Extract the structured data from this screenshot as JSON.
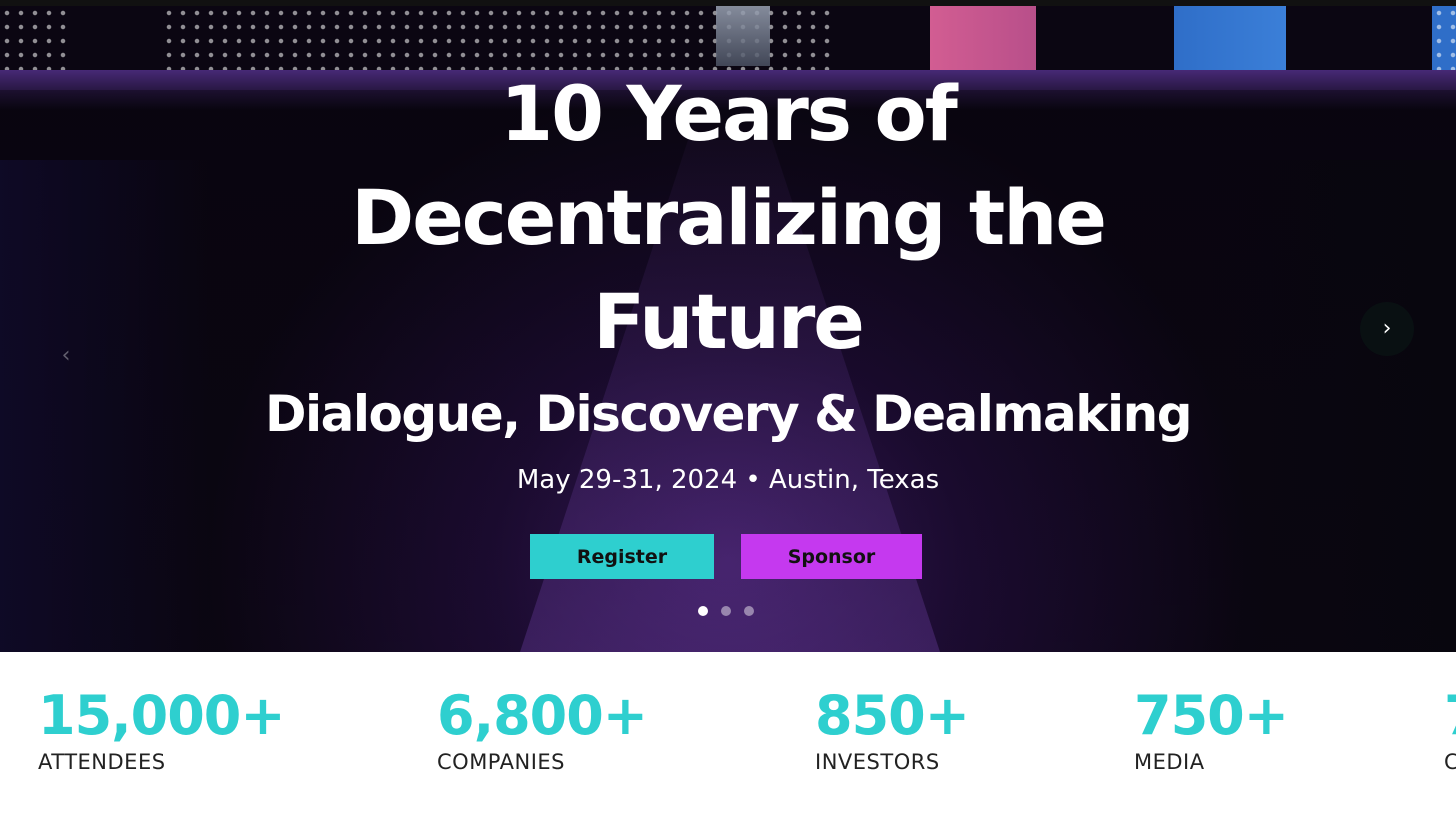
{
  "hero": {
    "headline": "10 Years of Decentralizing the Future",
    "subheadline": "Dialogue, Discovery & Dealmaking",
    "dateline": "May 29-31, 2024 • Austin, Texas",
    "register_label": "Register",
    "sponsor_label": "Sponsor",
    "carousel": {
      "slide_count": 3,
      "active_index": 0
    },
    "icons": {
      "prev": "chevron-left-icon",
      "next": "chevron-right-icon"
    }
  },
  "stats": [
    {
      "value": "15,000+",
      "label": "ATTENDEES"
    },
    {
      "value": "6,800+",
      "label": "COMPANIES"
    },
    {
      "value": "850+",
      "label": "INVESTORS"
    },
    {
      "value": "750+",
      "label": "MEDIA"
    },
    {
      "value": "7",
      "label": "C"
    }
  ],
  "colors": {
    "accent_cyan": "#2ecfcf",
    "accent_purple": "#c539ef",
    "hero_dark": "#0b0612"
  }
}
